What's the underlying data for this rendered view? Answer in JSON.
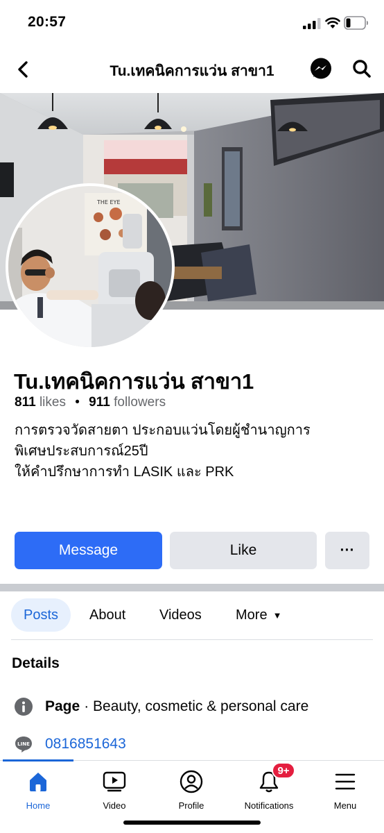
{
  "status_bar": {
    "time": "20:57"
  },
  "header": {
    "title": "Tu.เทคนิคการแว่น สาขา1"
  },
  "page": {
    "name": "Tu.เทคนิคการแว่น สาขา1",
    "likes_count": "811",
    "likes_label": "likes",
    "followers_count": "911",
    "followers_label": "followers",
    "bio_lines": [
      "การตรวจวัดสายตา ประกอบแว่นโดยผู้ชำนาญการ",
      "พิเศษประสบการณ์25ปี",
      "ให้คำปรึกษาการทำ LASIK และ PRK"
    ]
  },
  "actions": {
    "message_label": "Message",
    "like_label": "Like",
    "more_label": "···"
  },
  "tabs": [
    {
      "label": "Posts",
      "active": true
    },
    {
      "label": "About",
      "active": false
    },
    {
      "label": "Videos",
      "active": false
    },
    {
      "label": "More",
      "active": false
    }
  ],
  "details": {
    "title": "Details",
    "category_prefix": "Page",
    "category_text": "· Beauty, cosmetic & personal care",
    "phone": "0816851643"
  },
  "bottom_nav": [
    {
      "label": "Home",
      "icon": "home-icon",
      "active": true
    },
    {
      "label": "Video",
      "icon": "video-icon",
      "active": false
    },
    {
      "label": "Profile",
      "icon": "profile-icon",
      "active": false
    },
    {
      "label": "Notifications",
      "icon": "bell-icon",
      "active": false,
      "badge": "9+"
    },
    {
      "label": "Menu",
      "icon": "menu-icon",
      "active": false
    }
  ],
  "colors": {
    "accent": "#1b66d8",
    "message_button": "#2d6cf6",
    "badge": "#e41e3f",
    "secondary_button": "#e4e6eb"
  }
}
